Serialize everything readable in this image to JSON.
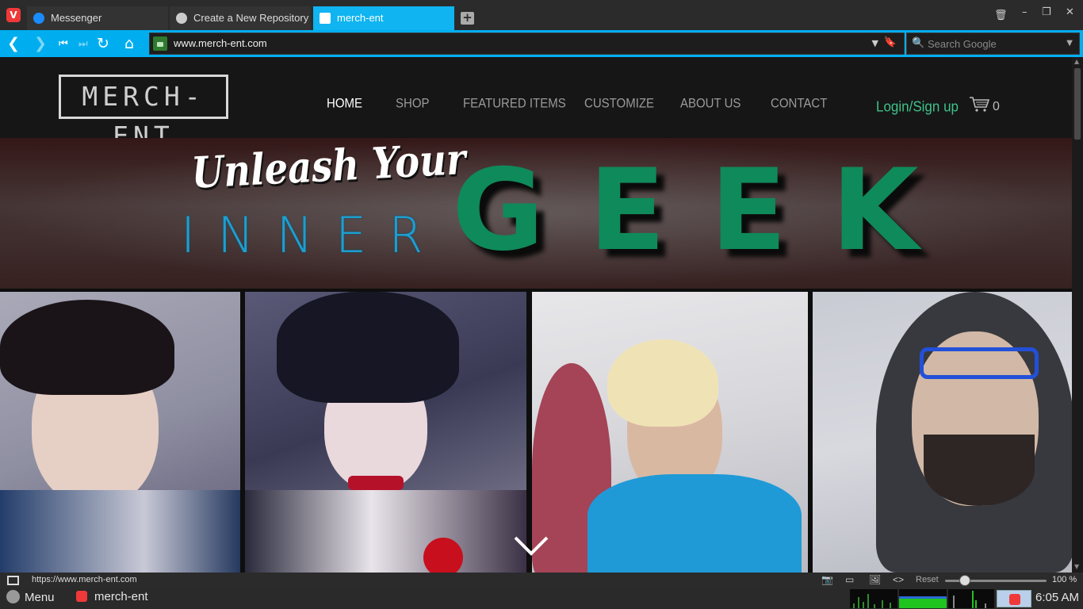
{
  "browser": {
    "tabs": [
      {
        "title": "Messenger",
        "icon": "messenger-icon",
        "active": false
      },
      {
        "title": "Create a New Repository",
        "icon": "github-icon",
        "active": false
      },
      {
        "title": "merch-ent",
        "icon": "page-icon",
        "active": true
      }
    ],
    "url": "www.merch-ent.com",
    "search_placeholder": "Search Google",
    "accent": "#00aef0"
  },
  "site": {
    "logo": "MERCH-ENT",
    "nav": [
      "HOME",
      "SHOP",
      "FEATURED ITEMS",
      "CUSTOMIZE",
      "ABOUT US",
      "CONTACT"
    ],
    "active_nav": "HOME",
    "login": "Login/Sign up",
    "cart_count": "0",
    "hero": {
      "line1": "Unleash Your",
      "line2": "INNER",
      "line3": "GEEK"
    },
    "colors": {
      "login": "#3ec28a",
      "geek": "#0f8a5a",
      "inner": "#1e9ecf"
    }
  },
  "statusbar": {
    "link": "https://www.merch-ent.com",
    "reset": "Reset",
    "zoom": "100 %"
  },
  "taskbar": {
    "menu": "Menu",
    "app": "merch-ent",
    "clock": "6:05 AM"
  }
}
